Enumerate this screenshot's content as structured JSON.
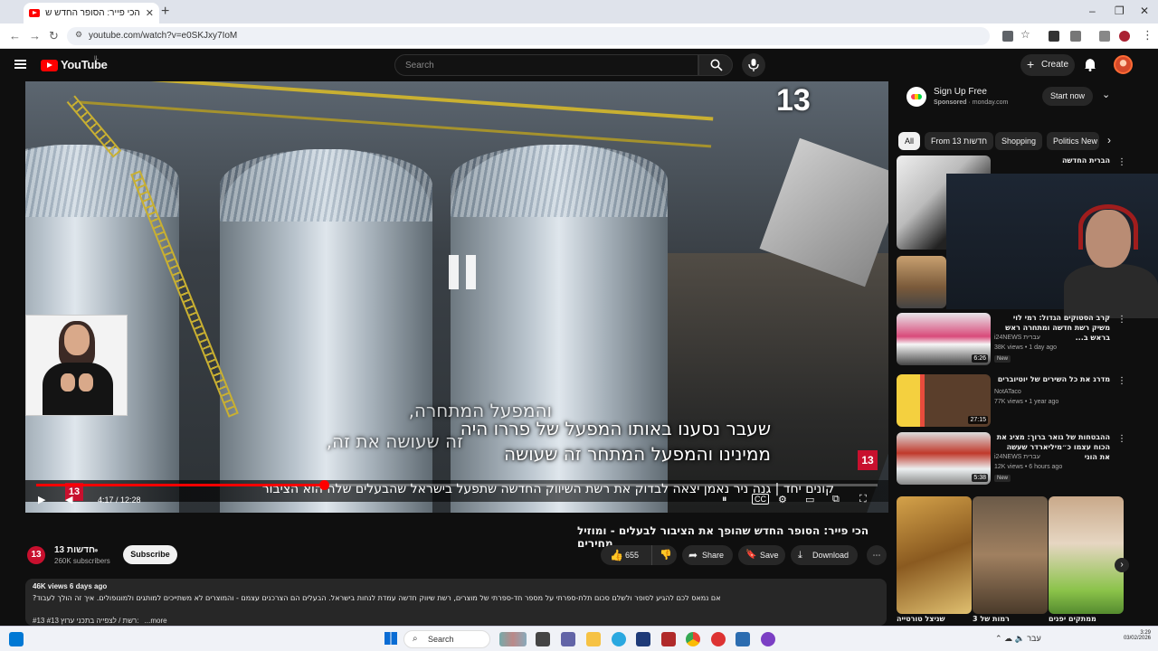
{
  "browser": {
    "tab_title": "הכי פייר: הסופר החדש שלה...",
    "url": "youtube.com/watch?v=e0SKJxy7IoM",
    "new_tab": "+",
    "close_tab": "✕"
  },
  "youtube": {
    "logo_text": "YouTube",
    "country": "IL",
    "search_placeholder": "Search",
    "create_label": "Create"
  },
  "video": {
    "subtitle_old_line1": "והמפעל המתחרה,",
    "subtitle_old_line2": "זה שעושה את זה,",
    "subtitle_line1": "שעבר נסענו באותו המפעל של פררו היה",
    "subtitle_line2": "ממינינו והמפעל המתחר זה שעושה",
    "ticker": "קונים יחד | גנה ניר נאמן יצאה לבדוק את רשת השיווק החדשה שתפעל בישראל שהבעלים שלה הוא הציבור",
    "time_current": "4:17",
    "time_total": "12:28",
    "time_display": "4:17 / 12:28",
    "progress_fraction": 0.342,
    "channel_watermark": "13"
  },
  "details": {
    "title": "הכי פייר: הסופר החדש שהופך את הציבור לבעלים - ומוזיל מחירים",
    "channel_name": "13 חדשות",
    "subscribers": "260K subscribers",
    "subscribe_label": "Subscribe",
    "likes": "655",
    "share_label": "Share",
    "save_label": "Save",
    "download_label": "Download",
    "views_date": "46K views  6 days ago",
    "description": "אם נמאס לכם להגיע לסופר ולשלם סכום תלת-ספרתי על מספר חד-ספרתי של מוצרים, רשת שיווק חדשה עמדת לנחות בישראל. הבעלים הם הצרכנים עצמם - והמוצרים לא משתייכים למותגים ולמונופולים. איך זה הולך לעבוד?",
    "hashtags": "#13 #רשת / לצפייה בתכני ערוץ 13:",
    "more_label": "...more"
  },
  "sidebar": {
    "ad": {
      "title": "Sign Up Free",
      "sponsored": "Sponsored",
      "domain": "monday.com",
      "cta": "Start now"
    },
    "chips": [
      "All",
      "From 13 חדשות",
      "Shopping",
      "Politics New"
    ],
    "recs": [
      {
        "title": "הברית החדשה",
        "channel": "",
        "meta": "",
        "duration": "",
        "badge": ""
      },
      {
        "title": "",
        "channel": "",
        "meta": "",
        "duration": "",
        "badge": ""
      },
      {
        "title": "קרב הסטוקים הגדול: רמי לוי משיק רשת חדשה ומתחרה ראש בראש ב...",
        "channel": "i24NEWS עברית",
        "meta": "38K views • 1 day ago",
        "duration": "6:26",
        "badge": "New"
      },
      {
        "title": "מדרג את כל השירים של יוטיוברים",
        "channel": "NotATaco",
        "meta": "77K views • 1 year ago",
        "duration": "27:15",
        "badge": ""
      },
      {
        "title": "ההבטחות של גואר ברוך: מציג את הכוח עצמו כ״מיליארדר שעשה את הוני",
        "channel": "i24NEWS עברית",
        "meta": "12K views • 6 hours ago",
        "duration": "5:38",
        "badge": "New"
      }
    ],
    "shorts": [
      {
        "title": "שניצל טורטייה"
      },
      {
        "title": "רמות של 3"
      },
      {
        "title": "ממתקים יפנים"
      }
    ]
  },
  "taskbar": {
    "search_label": "Search",
    "time": "3:29",
    "date": "03/02/2026",
    "lang": "עבר"
  },
  "colors": {
    "yt_red": "#ff0000",
    "channel13_red": "#c8102e",
    "dark_bg": "#0f0f0f"
  }
}
